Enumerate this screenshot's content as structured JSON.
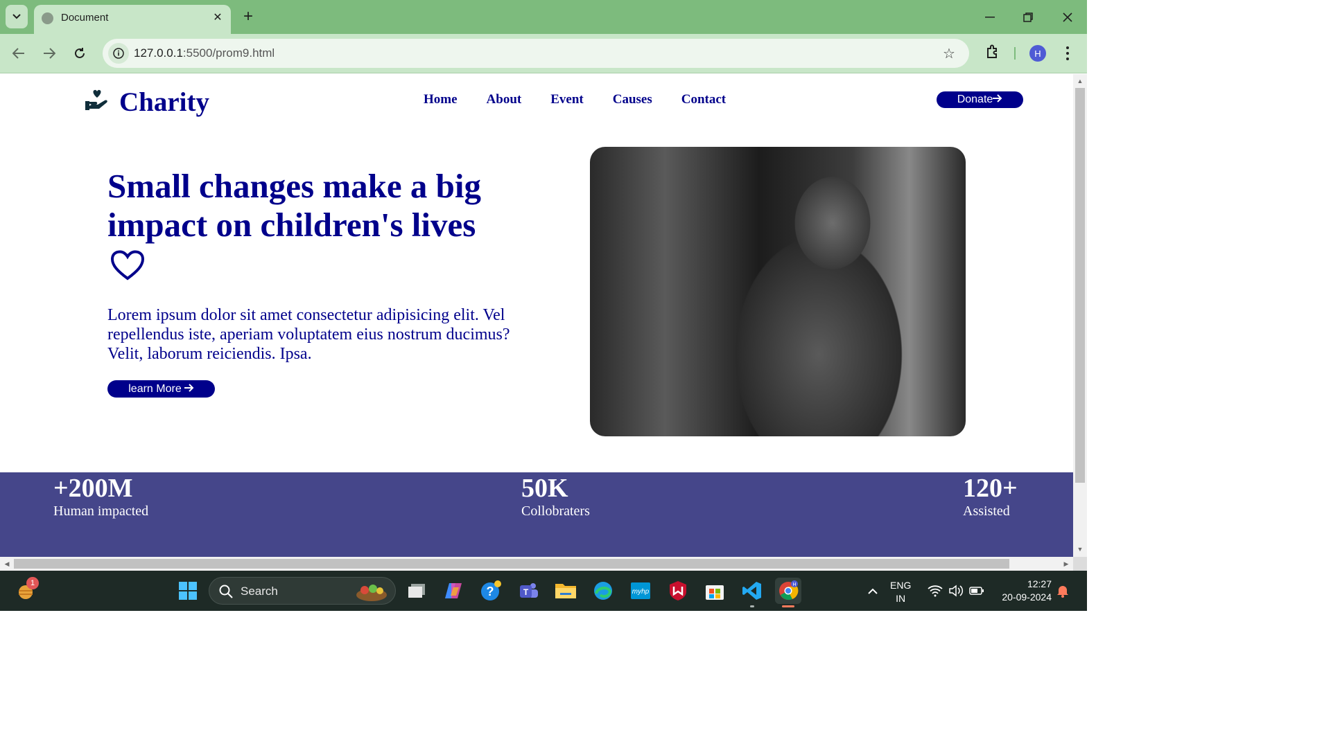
{
  "browser": {
    "tab_title": "Document",
    "url_host": "127.0.0.1",
    "url_path": ":5500/prom9.html",
    "profile_initial": "H"
  },
  "page": {
    "logo": "Charity",
    "nav": [
      "Home",
      "About",
      "Event",
      "Causes",
      "Contact"
    ],
    "donate_label": "Donate",
    "headline": "Small changes make a big impact on children's lives",
    "description": "Lorem ipsum dolor sit amet consectetur adipisicing elit. Vel repellendus iste, aperiam voluptatem eius nostrum ducimus? Velit, laborum reiciendis. Ipsa.",
    "learn_label": "learn More",
    "stats": [
      {
        "value": "+200M",
        "label": "Human impacted"
      },
      {
        "value": "50K",
        "label": "Collobraters"
      },
      {
        "value": "120+",
        "label": "Assisted"
      }
    ]
  },
  "taskbar": {
    "search_placeholder": "Search",
    "notification_count": "1",
    "language": "ENG",
    "region": "IN",
    "time": "12:27",
    "date": "20-09-2024"
  },
  "colors": {
    "chrome_tabbar": "#7dbb7d",
    "chrome_toolbar": "#c8e6c8",
    "brand_navy": "#00008b",
    "stats_band": "#45468a"
  }
}
